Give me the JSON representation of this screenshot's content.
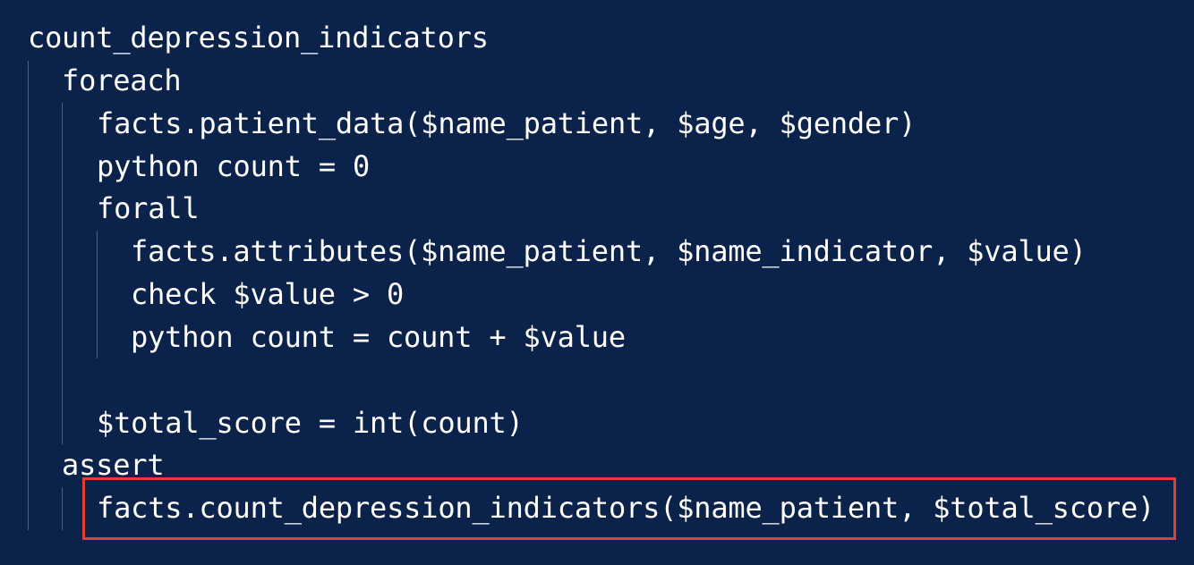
{
  "code": {
    "lines": [
      "count_depression_indicators",
      "foreach",
      "facts.patient_data($name_patient, $age, $gender)",
      "python count = 0",
      "forall",
      "facts.attributes($name_patient, $name_indicator, $value)",
      "check $value > 0",
      "python count = count + $value",
      "$total_score = int(count)",
      "assert",
      "facts.count_depression_indicators($name_patient, $total_score)"
    ]
  },
  "colors": {
    "background": "#0b224b",
    "text": "#ffffff",
    "indent_guide": "#4b5d84",
    "highlight_border": "#e0402f"
  }
}
